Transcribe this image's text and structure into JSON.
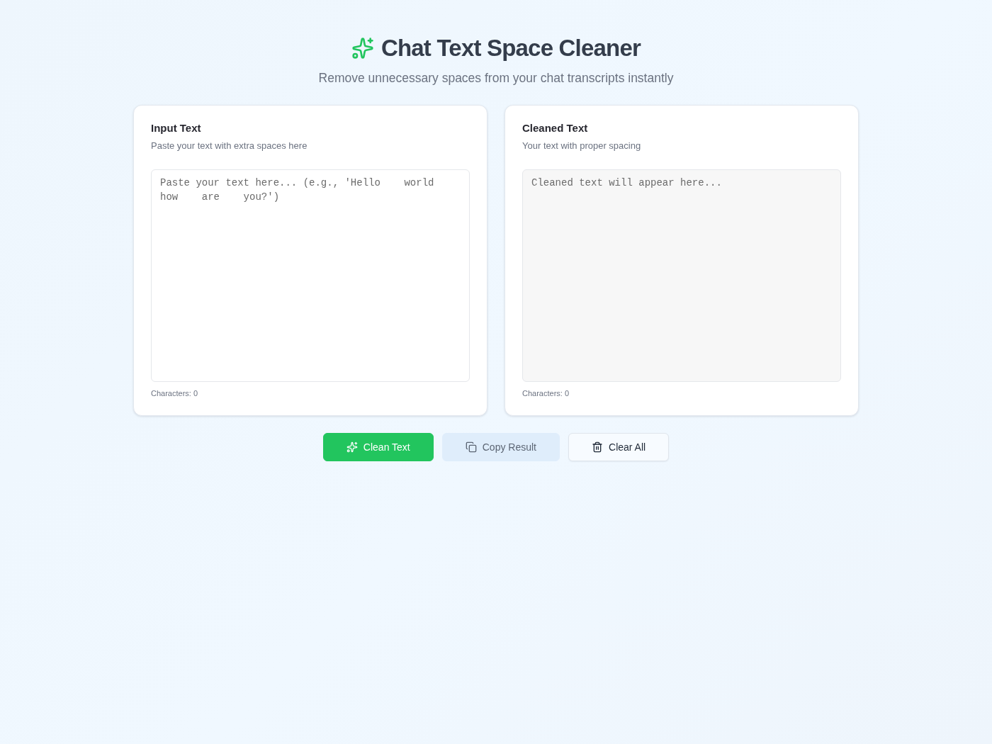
{
  "header": {
    "title": "Chat Text Space Cleaner",
    "subtitle": "Remove unnecessary spaces from your chat transcripts instantly"
  },
  "panels": [
    {
      "kind": "input",
      "title": "Input Text",
      "description": "Paste your text with extra spaces here",
      "placeholder": "Paste your text here... (e.g., 'Hello    world how    are    you?')",
      "count": "Characters: 0"
    },
    {
      "kind": "output",
      "title": "Cleaned Text",
      "description": "Your text with proper spacing",
      "placeholder": "Cleaned text will appear here...",
      "count": "Characters: 0"
    }
  ],
  "actions": [
    {
      "kind": "primary",
      "label": "Clean Text",
      "disabled": false
    },
    {
      "kind": "secondary",
      "label": "Copy Result",
      "disabled": true
    },
    {
      "kind": "outline",
      "label": "Clear All",
      "disabled": false
    }
  ]
}
